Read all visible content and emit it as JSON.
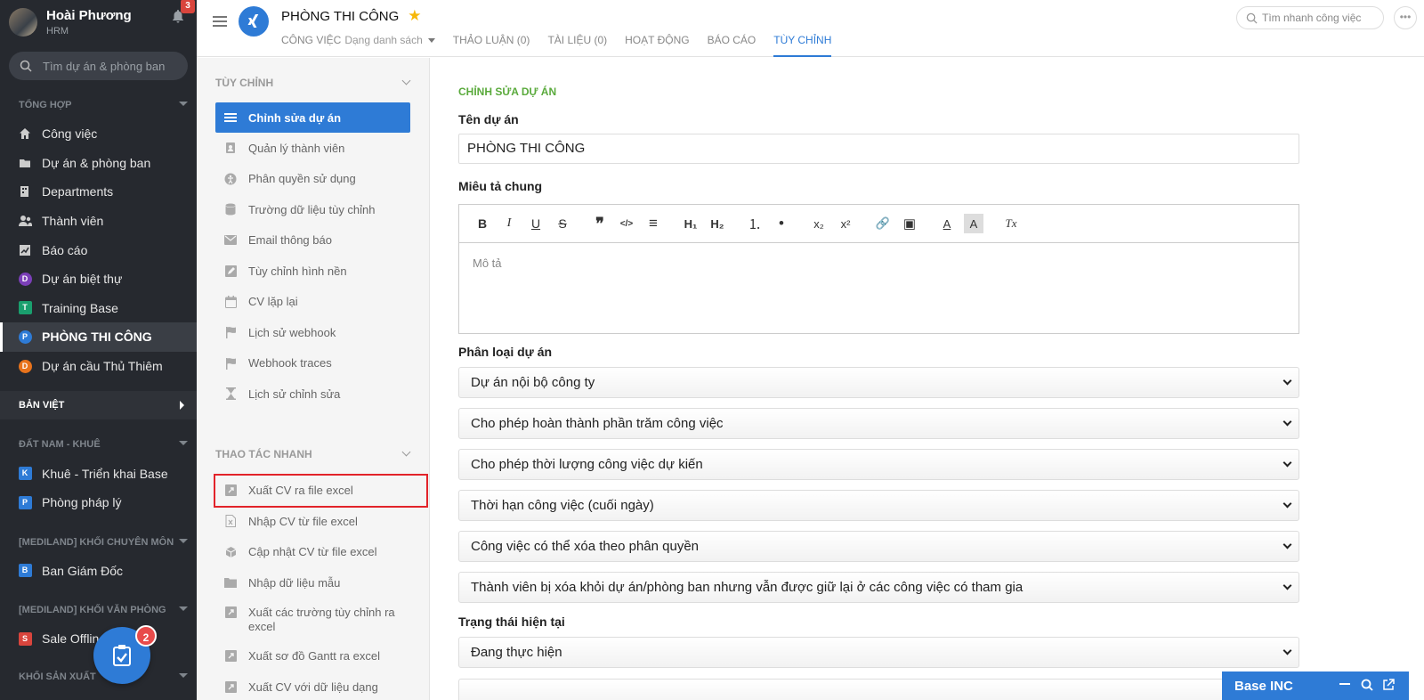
{
  "user": {
    "name": "Hoài Phương",
    "org": "HRM",
    "notif_count": "3"
  },
  "sidebar": {
    "search_placeholder": "Tìm dự án & phòng ban",
    "sections": [
      {
        "title": "TỔNG HỢP"
      },
      {
        "title": "BẢN VIỆT"
      },
      {
        "title": "ĐẤT NAM - KHUÊ"
      },
      {
        "title": "[MEDILAND] KHỐI CHUYÊN MÔN"
      },
      {
        "title": "[MEDILAND] KHỐI VĂN PHÒNG"
      },
      {
        "title": "KHỐI SẢN XUẤT"
      }
    ],
    "general_items": [
      {
        "label": "Công việc",
        "icon": "home-icon"
      },
      {
        "label": "Dự án & phòng ban",
        "icon": "folder-icon"
      },
      {
        "label": "Departments",
        "icon": "building-icon"
      },
      {
        "label": "Thành viên",
        "icon": "users-icon"
      },
      {
        "label": "Báo cáo",
        "icon": "chart-icon"
      },
      {
        "label": "Dự án biệt thự",
        "letter": "D",
        "color": "#7b3fb8"
      },
      {
        "label": "Training Base",
        "letter": "T",
        "color": "#1a9f6e"
      },
      {
        "label": "PHÒNG THI CÔNG",
        "letter": "P",
        "color": "#2e7bd6"
      },
      {
        "label": "Dự án cầu Thủ Thiêm",
        "letter": "D",
        "color": "#e8731c"
      }
    ],
    "dat_nam_items": [
      {
        "label": "Khuê - Triển khai Base",
        "letter": "K",
        "color": "#2e7bd6"
      },
      {
        "label": "Phòng pháp lý",
        "letter": "P",
        "color": "#2e7bd6"
      }
    ],
    "chuyen_mon_items": [
      {
        "label": "Ban Giám Đốc",
        "letter": "B",
        "color": "#2e7bd6"
      }
    ],
    "van_phong_items": [
      {
        "label": "Sale Offline",
        "letter": "S",
        "color": "#d9453d"
      }
    ],
    "fab_badge": "2"
  },
  "header": {
    "title": "PHÒNG THI CÔNG",
    "tabs": [
      {
        "label": "CÔNG VIỆC",
        "sub": "Dạng danh sách"
      },
      {
        "label": "THẢO LUẬN (0)"
      },
      {
        "label": "TÀI LIỆU (0)"
      },
      {
        "label": "HOẠT ĐỘNG"
      },
      {
        "label": "BÁO CÁO"
      },
      {
        "label": "TÙY CHỈNH"
      }
    ],
    "search_placeholder": "Tìm nhanh công việc",
    "more_label": "•••"
  },
  "custom_panel": {
    "section1": "TÙY CHỈNH",
    "items1": [
      {
        "label": "Chỉnh sửa dự án",
        "icon": "list-icon"
      },
      {
        "label": "Quản lý thành viên",
        "icon": "contact-icon"
      },
      {
        "label": "Phân quyền sử dụng",
        "icon": "accessibility-icon"
      },
      {
        "label": "Trường dữ liệu tùy chỉnh",
        "icon": "database-icon"
      },
      {
        "label": "Email thông báo",
        "icon": "mail-icon"
      },
      {
        "label": "Tùy chỉnh hình nền",
        "icon": "edit-icon"
      },
      {
        "label": "CV lặp lại",
        "icon": "calendar-icon"
      },
      {
        "label": "Lịch sử webhook",
        "icon": "flag-icon"
      },
      {
        "label": "Webhook traces",
        "icon": "flag-icon"
      },
      {
        "label": "Lịch sử chỉnh sửa",
        "icon": "hourglass-icon"
      }
    ],
    "section2": "THAO TÁC NHANH",
    "items2": [
      {
        "label": "Xuất CV ra file excel",
        "icon": "export-icon"
      },
      {
        "label": "Nhập CV từ file excel",
        "icon": "excel-file-icon"
      },
      {
        "label": "Cập nhật CV từ file excel",
        "icon": "box-icon"
      },
      {
        "label": "Nhập dữ liệu mẫu",
        "icon": "folder-icon"
      },
      {
        "label": "Xuất các trường tùy chỉnh ra excel",
        "icon": "export-icon"
      },
      {
        "label": "Xuất sơ đồ Gantt ra excel",
        "icon": "export-icon"
      },
      {
        "label": "Xuất CV với dữ liệu dạng",
        "icon": "export-icon"
      }
    ]
  },
  "main": {
    "section_title": "CHỈNH SỬA DỰ ÁN",
    "name_label": "Tên dự án",
    "name_value": "PHÒNG THI CÔNG",
    "desc_label": "Miêu tả chung",
    "desc_placeholder": "Mô tả",
    "toolbar": [
      {
        "sym": "B",
        "name": "bold-icon"
      },
      {
        "sym": "I",
        "name": "italic-icon"
      },
      {
        "sym": "U",
        "name": "underline-icon"
      },
      {
        "sym": "S",
        "name": "strike-icon"
      },
      {
        "sym": "❞",
        "name": "quote-icon"
      },
      {
        "sym": "</>",
        "name": "code-icon"
      },
      {
        "sym": "≡",
        "name": "align-icon"
      },
      {
        "sym": "H₁",
        "name": "h1-icon"
      },
      {
        "sym": "H₂",
        "name": "h2-icon"
      },
      {
        "sym": "⒈",
        "name": "ordered-list-icon"
      },
      {
        "sym": "•",
        "name": "bullet-list-icon"
      },
      {
        "sym": "x₂",
        "name": "subscript-icon"
      },
      {
        "sym": "x²",
        "name": "superscript-icon"
      },
      {
        "sym": "🔗",
        "name": "link-icon"
      },
      {
        "sym": "▣",
        "name": "image-icon"
      },
      {
        "sym": "A",
        "name": "font-color-icon"
      },
      {
        "sym": "A",
        "name": "highlight-icon"
      },
      {
        "sym": "Tx",
        "name": "clear-format-icon"
      }
    ],
    "category_label": "Phân loại dự án",
    "category_selects": [
      "Dự án nội bộ công ty",
      "Cho phép hoàn thành phần trăm công việc",
      "Cho phép thời lượng công việc dự kiến",
      "Thời hạn công việc (cuối ngày)",
      "Công việc có thể xóa theo phân quyền",
      "Thành viên bị xóa khỏi dự án/phòng ban nhưng vẫn được giữ lại ở các công việc có tham gia"
    ],
    "status_label": "Trạng thái hiện tại",
    "status_value": "Đang thực hiện"
  },
  "chat": {
    "label": "Base INC"
  }
}
